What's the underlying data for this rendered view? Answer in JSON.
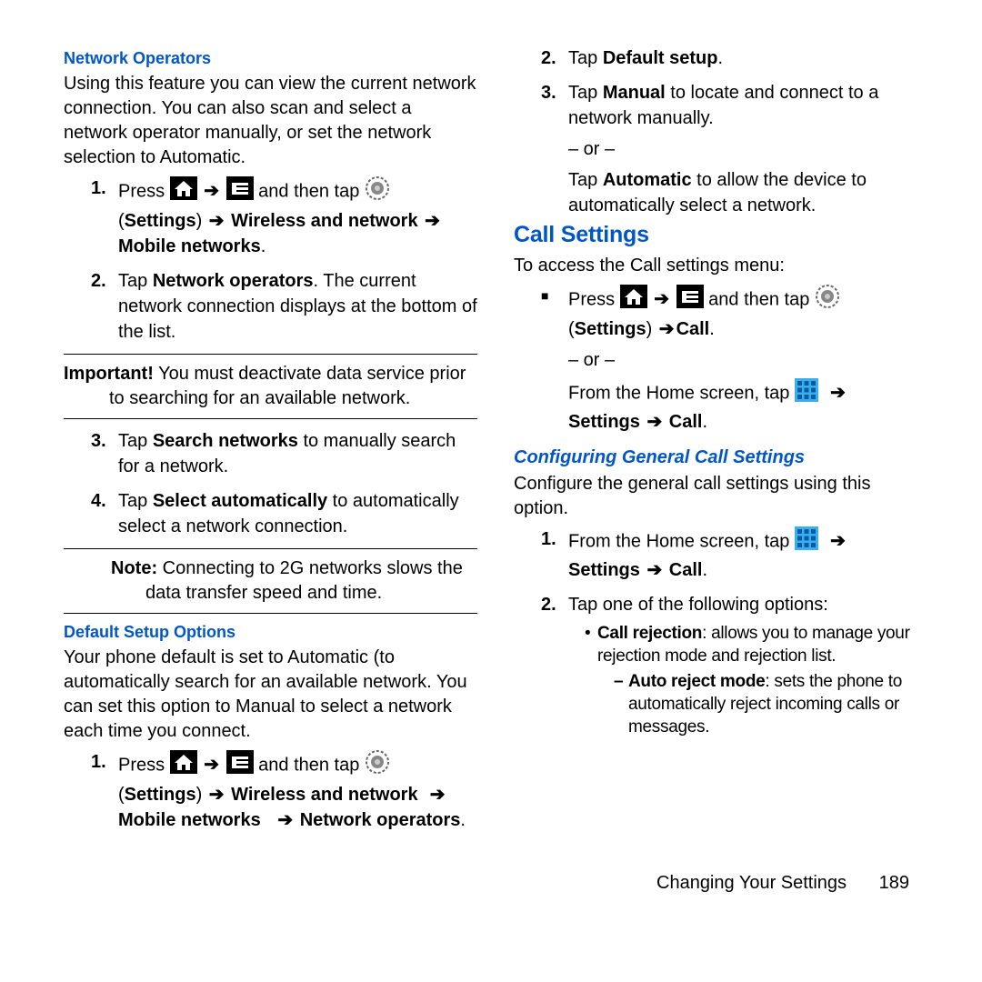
{
  "left": {
    "h_net_ops": "Network Operators",
    "net_ops_intro": "Using this feature you can view the current network connection. You can also scan and select a network operator manually, or set the network selection to Automatic.",
    "step1_press": "Press",
    "step1_tap": " and then tap ",
    "settings_label": "Settings",
    "wireless_label": "Wireless and network",
    "mobile_label": "Mobile networks",
    "step2a": "Tap ",
    "step2b": "Network operators",
    "step2c": ". The current network connection displays at the bottom of the list.",
    "important_label": "Important!",
    "important_text": " You must deactivate data service prior to searching for an available network.",
    "step3a": "Tap ",
    "step3b": "Search networks",
    "step3c": " to manually search for a network.",
    "step4a": "Tap ",
    "step4b": "Select automatically",
    "step4c": " to automatically select a network connection.",
    "note_label": "Note:",
    "note_text": " Connecting to 2G networks slows the data transfer speed and time.",
    "h_default": "Default Setup Options",
    "default_text": "Your phone default is set to Automatic (to automatically search for an available network. You can set this option to Manual to select a network each time you connect."
  },
  "right": {
    "net_ops_label": "Network operators",
    "step2a": "Tap ",
    "step2b": "Default setup",
    "step3a": "Tap ",
    "step3b": "Manual",
    "step3c": " to locate and connect to a network manually.",
    "or": "– or –",
    "step3d": "Tap ",
    "step3e": "Automatic",
    "step3f": " to allow the device to automatically select a network.",
    "h_call": "Call Settings",
    "call_intro": "To access the Call settings menu:",
    "bullet_press": "Press",
    "bullet_tap": " and then tap ",
    "bullet_call": "Call",
    "bullet_from": "From the Home screen, tap ",
    "bullet_settings_call": "Settings ",
    "h_conf": "Configuring General Call Settings",
    "conf_text": "Configure the general call settings using this option.",
    "cstep1a": "From the Home screen, tap ",
    "cstep2": "Tap one of the following options:",
    "sub_cr": "Call rejection",
    "sub_cr_text": ": allows you to manage your rejection mode and rejection list.",
    "dash_arm": "Auto reject mode",
    "dash_arm_text": ": sets the phone to automatically reject incoming calls or messages."
  },
  "footer": {
    "section": "Changing Your Settings",
    "page": "189"
  }
}
